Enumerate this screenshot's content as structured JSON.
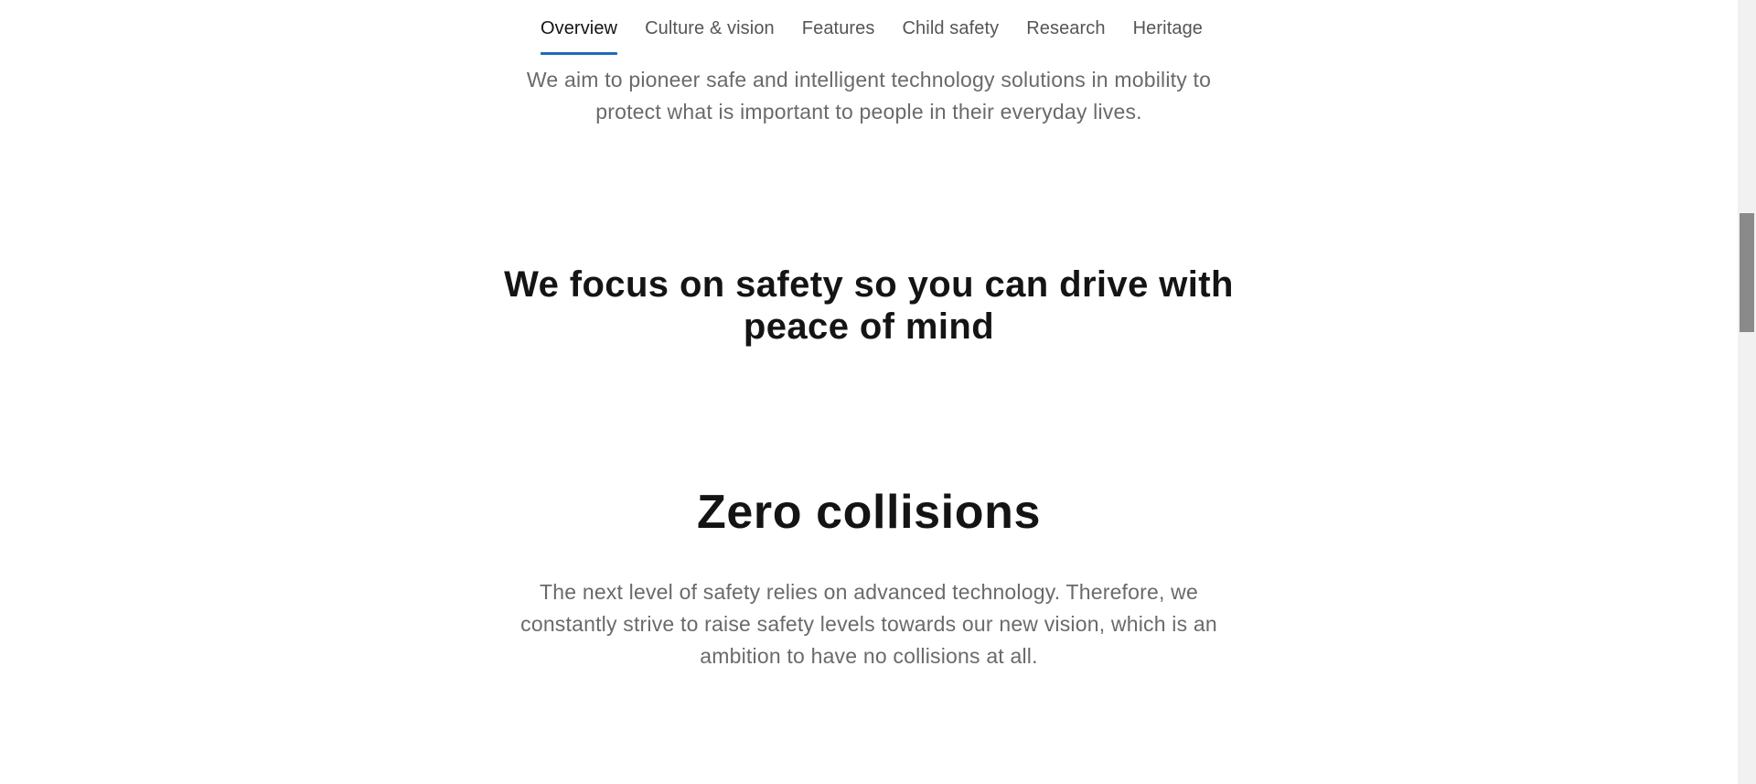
{
  "subnav": {
    "items": [
      {
        "label": "Overview",
        "active": true
      },
      {
        "label": "Culture & vision",
        "active": false
      },
      {
        "label": "Features",
        "active": false
      },
      {
        "label": "Child safety",
        "active": false
      },
      {
        "label": "Research",
        "active": false
      },
      {
        "label": "Heritage",
        "active": false
      }
    ]
  },
  "intro": {
    "text": "We aim to pioneer safe and intelligent technology solutions in mobility to protect what is important to people in their everyday lives."
  },
  "focus": {
    "heading": "We focus on safety so you can drive with peace of mind"
  },
  "zero_collisions": {
    "heading": "Zero collisions",
    "body": "The next level of safety relies on advanced technology. Therefore, we constantly strive to raise safety levels towards our new vision, which is an ambition to have no collisions at all."
  },
  "colors": {
    "accent": "#1c6bba",
    "heading": "#141414",
    "body_text": "#6a6a6a",
    "nav_text": "#555555"
  }
}
